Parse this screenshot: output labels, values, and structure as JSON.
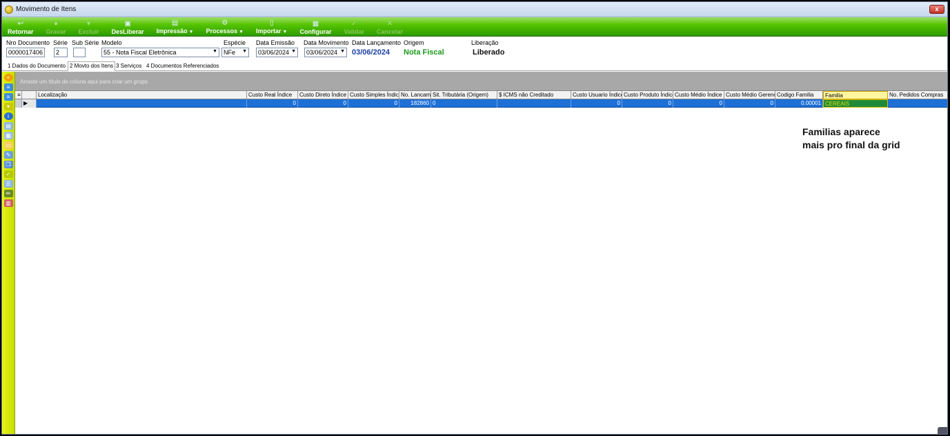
{
  "window": {
    "title": "Movimento de Itens",
    "close_label": "x"
  },
  "toolbar": {
    "buttons": [
      {
        "label": "Retornar",
        "icon": "↩",
        "enabled": true
      },
      {
        "label": "Gravar",
        "icon": "●",
        "enabled": false
      },
      {
        "label": "Excluir",
        "icon": "▾",
        "enabled": false
      },
      {
        "label": "DesLiberar",
        "icon": "▣",
        "enabled": true
      },
      {
        "label": "Impressão",
        "icon": "▤",
        "enabled": true,
        "dropdown": true
      },
      {
        "label": "Processos",
        "icon": "⚙",
        "enabled": true,
        "dropdown": true
      },
      {
        "label": "Importar",
        "icon": "▯",
        "enabled": true,
        "dropdown": true
      },
      {
        "label": "Configurar",
        "icon": "▦",
        "enabled": true
      },
      {
        "label": "Validar",
        "icon": "✓",
        "enabled": false
      },
      {
        "label": "Cancelar",
        "icon": "✕",
        "enabled": false
      }
    ]
  },
  "form": {
    "nro_documento": {
      "label": "Nro Documento",
      "value": "0000017406"
    },
    "serie": {
      "label": "Série",
      "value": "2"
    },
    "sub_serie": {
      "label": "Sub Série",
      "value": ""
    },
    "modelo": {
      "label": "Modelo",
      "value": "55 - Nota Fiscal Eletrônica"
    },
    "especie": {
      "label": "Espécie",
      "value": "NFe"
    },
    "data_emissao": {
      "label": "Data Emissão",
      "value": "03/06/2024"
    },
    "data_movimento": {
      "label": "Data Movimento",
      "value": "03/06/2024"
    },
    "data_lancamento": {
      "label": "Data Lançamento",
      "value": "03/06/2024"
    },
    "origem": {
      "label": "Origem",
      "value": "Nota Fiscal"
    },
    "liberacao": {
      "label": "Liberação",
      "value": "Liberado"
    }
  },
  "tabs": [
    {
      "label": "1 Dados do Documento",
      "active": false
    },
    {
      "label": "2 Movto dos Itens",
      "active": true
    },
    {
      "label": "3 Serviços",
      "active": false
    },
    {
      "label": "4 Documentos Referenciados",
      "active": false
    }
  ],
  "sidebar": {
    "icons": [
      "add-icon",
      "filter-icon",
      "filter-down-icon",
      "trash-icon",
      "info-icon",
      "table-icon",
      "grid-icon",
      "note-icon",
      "edit-icon",
      "copy-icon",
      "check-icon",
      "list-icon",
      "pen-icon",
      "report-icon"
    ]
  },
  "grid": {
    "group_hint": "Arraste um título de coluna aqui para criar um grupo",
    "columns": [
      "Localização",
      "Custo Real Índice",
      "Custo Direto Índice",
      "Custo Simples Índice",
      "No. Lancam",
      "Sit. Tributária (Origem)",
      "$ ICMS não Creditado",
      "Custo Usuario Índice",
      "Custo Produto Índice",
      "Custo Médio Índice",
      "Custo Médio Gerenc",
      "Codigo Familia",
      "Familia",
      "No. Pedidos Compras"
    ],
    "row": [
      "",
      "0",
      "0",
      "0",
      "182860",
      "0",
      "",
      "0",
      "0",
      "0",
      "0",
      "0.00001",
      "CEREAIS",
      ""
    ]
  },
  "annotation": {
    "line1": "Familias aparece",
    "line2": "mais pro final da grid"
  },
  "colors": {
    "toolbar_green": "#3cae00",
    "sidebar_yellow": "#d9ea00",
    "selected_row": "#1e70d6",
    "origem_green": "#1a9a1a",
    "date_blue": "#1a3fa6"
  }
}
